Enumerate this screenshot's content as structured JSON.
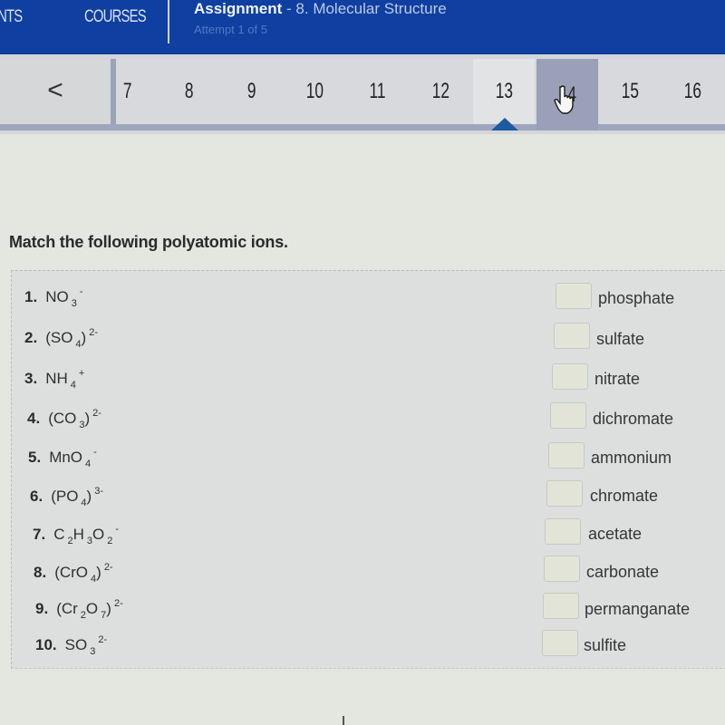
{
  "header": {
    "nav": [
      {
        "label": "ENTS",
        "name": "nav-students"
      },
      {
        "label": "COURSES",
        "name": "nav-courses"
      }
    ],
    "assignment_label": "Assignment",
    "assignment_name": "- 8. Molecular Structure",
    "attempt": "Attempt 1 of 5"
  },
  "question_nav": {
    "prev_label": "<",
    "questions": [
      "7",
      "8",
      "9",
      "10",
      "11",
      "12",
      "13",
      "14",
      "15",
      "16"
    ],
    "current": "13",
    "hovered": "14",
    "accent_color": "#1d5a9e"
  },
  "question": {
    "prompt": "Match the following polyatomic ions.",
    "items": [
      {
        "num": "1.",
        "parts": [
          {
            "t": "NO"
          },
          {
            "sub": "3"
          },
          {
            "sup": "-"
          }
        ]
      },
      {
        "num": "2.",
        "parts": [
          {
            "t": "(SO"
          },
          {
            "sub": "4"
          },
          {
            "t": ")"
          },
          {
            "sup": "2-"
          }
        ]
      },
      {
        "num": "3.",
        "parts": [
          {
            "t": "NH"
          },
          {
            "sub": "4"
          },
          {
            "sup": "+"
          }
        ]
      },
      {
        "num": "4.",
        "parts": [
          {
            "t": "(CO"
          },
          {
            "sub": "3"
          },
          {
            "t": ")"
          },
          {
            "sup": "2-"
          }
        ]
      },
      {
        "num": "5.",
        "parts": [
          {
            "t": "MnO"
          },
          {
            "sub": "4"
          },
          {
            "sup": "-"
          }
        ]
      },
      {
        "num": "6.",
        "parts": [
          {
            "t": "(PO"
          },
          {
            "sub": "4"
          },
          {
            "t": ")"
          },
          {
            "sup": "3-"
          }
        ]
      },
      {
        "num": "7.",
        "parts": [
          {
            "t": "C"
          },
          {
            "sub": "2"
          },
          {
            "t": "H"
          },
          {
            "sub": "3"
          },
          {
            "t": "O"
          },
          {
            "sub": "2"
          },
          {
            "sup": "-"
          }
        ]
      },
      {
        "num": "8.",
        "parts": [
          {
            "t": "(CrO"
          },
          {
            "sub": "4"
          },
          {
            "t": ")"
          },
          {
            "sup": "2-"
          }
        ]
      },
      {
        "num": "9.",
        "parts": [
          {
            "t": "(Cr"
          },
          {
            "sub": "2"
          },
          {
            "t": "O"
          },
          {
            "sub": "7"
          },
          {
            "t": ")"
          },
          {
            "sup": "2-"
          }
        ]
      },
      {
        "num": "10.",
        "parts": [
          {
            "t": "SO"
          },
          {
            "sub": "3"
          },
          {
            "sup": "2-"
          }
        ]
      }
    ],
    "answers": [
      {
        "label": "phosphate",
        "value": ""
      },
      {
        "label": "sulfate",
        "value": ""
      },
      {
        "label": "nitrate",
        "value": ""
      },
      {
        "label": "dichromate",
        "value": ""
      },
      {
        "label": "ammonium",
        "value": ""
      },
      {
        "label": "chromate",
        "value": ""
      },
      {
        "label": "acetate",
        "value": ""
      },
      {
        "label": "carbonate",
        "value": ""
      },
      {
        "label": "permanganate",
        "value": ""
      },
      {
        "label": "sulfite",
        "value": ""
      }
    ]
  }
}
